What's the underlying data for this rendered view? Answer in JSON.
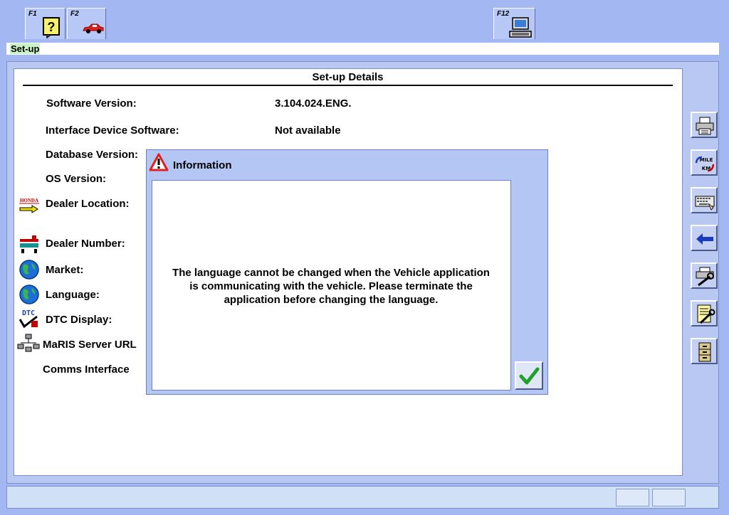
{
  "function_keys": {
    "f1": {
      "label": "F1",
      "icon": "help-question-icon"
    },
    "f2": {
      "label": "F2",
      "icon": "car-icon"
    },
    "f12": {
      "label": "F12",
      "icon": "computer-icon"
    }
  },
  "title_bar": {
    "text": "Set-up"
  },
  "details": {
    "heading": "Set-up Details",
    "rows": [
      {
        "label": "Software Version:",
        "value": "3.104.024.ENG."
      },
      {
        "label": "Interface Device Software:",
        "value": "Not available"
      },
      {
        "label": "Database Version:",
        "value": ""
      },
      {
        "label": "OS Version:",
        "value": ""
      },
      {
        "label": "Dealer Location:",
        "value": "",
        "icon": "honda-dealer-icon",
        "icon_text": "HONDA"
      },
      {
        "label": "Dealer Number:",
        "value": "",
        "icon": "dealer-number-icon"
      },
      {
        "label": "Market:",
        "value": "",
        "icon": "globe-icon"
      },
      {
        "label": "Language:",
        "value": "",
        "icon": "globe-icon"
      },
      {
        "label": "DTC Display:",
        "value": "",
        "icon": "dtc-icon",
        "icon_text": "DTC"
      },
      {
        "label": "MaRIS Server URL",
        "value": "",
        "icon": "network-icon"
      },
      {
        "label": "Comms Interface",
        "value": ""
      }
    ]
  },
  "right_toolbar": [
    {
      "name": "print-button",
      "icon": "printer-icon"
    },
    {
      "name": "mile-km-button",
      "icon": "mile-km-icon",
      "text_top": "MILE",
      "text_bottom": "KM"
    },
    {
      "name": "keyboard-button",
      "icon": "keyboard-icon"
    },
    {
      "name": "back-button",
      "icon": "arrow-left-icon"
    },
    {
      "name": "printer-settings-button",
      "icon": "printer-wrench-icon"
    },
    {
      "name": "document-settings-button",
      "icon": "document-wrench-icon"
    },
    {
      "name": "file-cabinet-button",
      "icon": "file-cabinet-icon"
    }
  ],
  "dialog": {
    "title": "Information",
    "message_lines": [
      "The language cannot be changed when the Vehicle application",
      "is communicating with the vehicle. Please terminate the",
      "application before changing the language."
    ],
    "ok_icon": "checkmark-icon"
  },
  "colors": {
    "background": "#a3b8f2",
    "title_highlight": "#c9f2c5",
    "ok_check": "#1fa12a",
    "warning": "#e02020"
  }
}
